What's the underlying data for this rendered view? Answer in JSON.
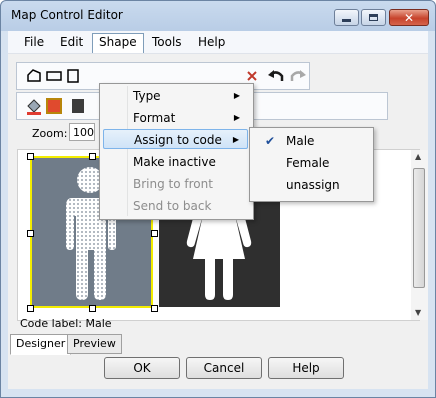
{
  "window": {
    "title": "Map Control Editor",
    "colors": {
      "selection_border": "#f3ed00",
      "male_bg": "#707c89",
      "female_bg": "#2f2f2f",
      "highlight": "#cfe3f7"
    }
  },
  "menubar": {
    "items": [
      {
        "label": "File"
      },
      {
        "label": "Edit"
      },
      {
        "label": "Shape"
      },
      {
        "label": "Tools"
      },
      {
        "label": "Help"
      }
    ]
  },
  "shape_menu": {
    "items": [
      {
        "label": "Type",
        "submenu": true,
        "enabled": true
      },
      {
        "label": "Format",
        "submenu": true,
        "enabled": true
      },
      {
        "label": "Assign to code",
        "submenu": true,
        "enabled": true,
        "highlighted": true
      },
      {
        "label": "Make inactive",
        "submenu": false,
        "enabled": true
      },
      {
        "label": "Bring to front",
        "submenu": false,
        "enabled": false
      },
      {
        "label": "Send to back",
        "submenu": false,
        "enabled": false
      }
    ]
  },
  "assign_submenu": {
    "items": [
      {
        "label": "Male",
        "checked": true
      },
      {
        "label": "Female",
        "checked": false
      },
      {
        "label": "unassign",
        "checked": false
      }
    ]
  },
  "toolbar": {
    "zoom_label": "Zoom:",
    "zoom_value": "100"
  },
  "canvas": {
    "code_label": "Code label: Male"
  },
  "tabs": [
    {
      "label": "Designer",
      "active": true
    },
    {
      "label": "Preview",
      "active": false
    }
  ],
  "buttons": {
    "ok": "OK",
    "cancel": "Cancel",
    "help": "Help"
  }
}
